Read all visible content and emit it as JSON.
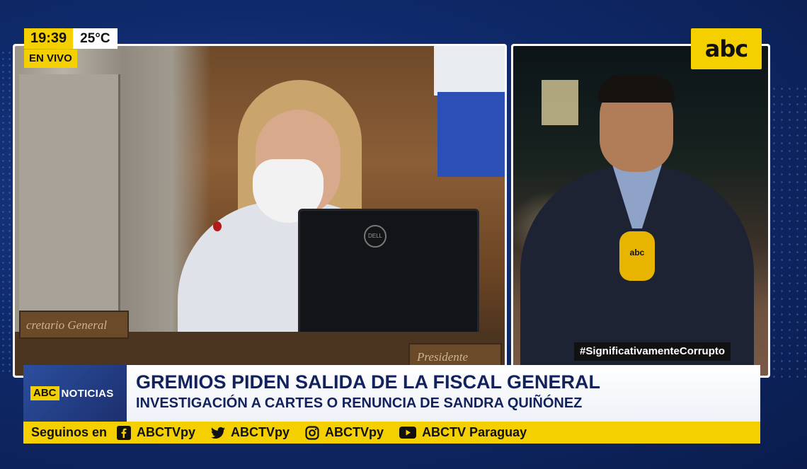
{
  "overlay": {
    "time": "19:39",
    "temperature": "25°C",
    "live_label": "EN VIVO",
    "channel_logo": "abc",
    "hashtag": "#SignificativamenteCorrupto"
  },
  "scene_left": {
    "nameplate_left": "cretario General",
    "nameplate_right": "Presidente",
    "monitor_logo": "DELL"
  },
  "scene_right": {
    "mic_logo": "abc"
  },
  "lower_third": {
    "brand_abc": "ABC",
    "brand_noticias": "NOTICIAS",
    "headline": "GREMIOS PIDEN SALIDA DE LA FISCAL GENERAL",
    "subheadline": "INVESTIGACIÓN A CARTES O RENUNCIA DE SANDRA QUIÑÓNEZ"
  },
  "social_bar": {
    "label": "Seguinos en",
    "items": [
      {
        "icon": "facebook-icon",
        "handle": "ABCTVpy"
      },
      {
        "icon": "twitter-icon",
        "handle": "ABCTVpy"
      },
      {
        "icon": "instagram-icon",
        "handle": "ABCTVpy"
      },
      {
        "icon": "youtube-icon",
        "handle": "ABCTV Paraguay"
      }
    ]
  },
  "colors": {
    "brand_yellow": "#f5d000",
    "brand_navy": "#12225c",
    "background_blue": "#0f2a6b"
  }
}
